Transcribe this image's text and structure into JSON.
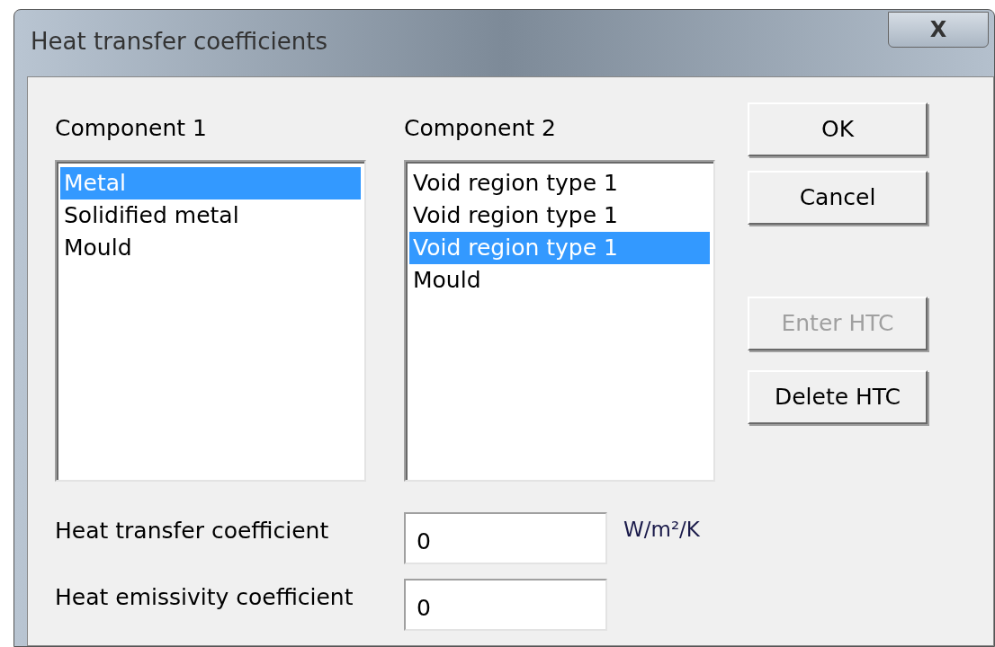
{
  "window": {
    "title": "Heat transfer coefficients",
    "close": "X"
  },
  "component_1": {
    "label": "Component 1",
    "items": [
      {
        "label": "Metal",
        "selected": true
      },
      {
        "label": "Solidified metal",
        "selected": false
      },
      {
        "label": "Mould",
        "selected": false
      }
    ]
  },
  "component_2": {
    "label": "Component 2",
    "items": [
      {
        "label": "Void region type 1",
        "selected": false
      },
      {
        "label": "Void region type 1",
        "selected": false
      },
      {
        "label": "Void region type 1",
        "selected": true
      },
      {
        "label": "Mould",
        "selected": false
      }
    ]
  },
  "buttons": [
    {
      "label": "OK",
      "disabled": false
    },
    {
      "label": "Cancel",
      "disabled": false
    },
    {
      "label": "Enter HTC",
      "disabled": true
    },
    {
      "label": "Delete HTC",
      "disabled": false
    }
  ],
  "fields": [
    {
      "label": "Heat transfer coefficient",
      "value": "0",
      "unit": "W/m²/K"
    },
    {
      "label": "Heat emissivity coefficient",
      "value": "0"
    }
  ]
}
